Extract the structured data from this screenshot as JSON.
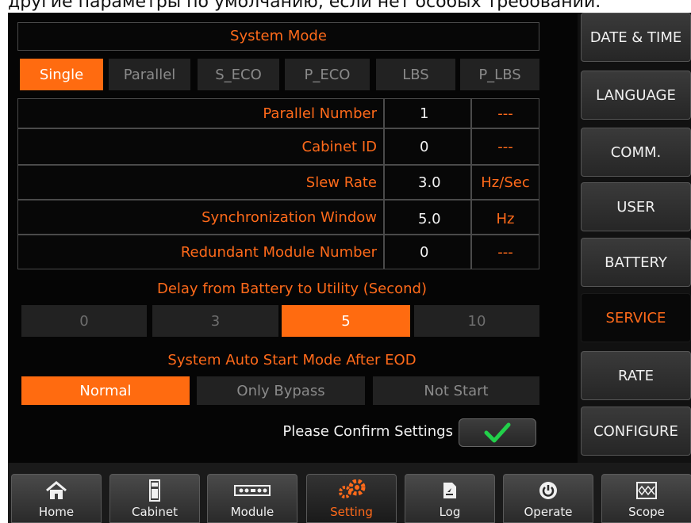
{
  "top_caption": "другие параметры по умолчанию, если нет особых требований.",
  "system_mode": {
    "title": "System Mode",
    "options": [
      "Single",
      "Parallel",
      "S_ECO",
      "P_ECO",
      "LBS",
      "P_LBS"
    ],
    "selected": "Single"
  },
  "params": [
    {
      "label": "Parallel Number",
      "value": "1",
      "unit": "---"
    },
    {
      "label": "Cabinet ID",
      "value": "0",
      "unit": "---"
    },
    {
      "label": "Slew Rate",
      "value": "3.0",
      "unit": "Hz/Sec"
    },
    {
      "label": "Synchronization Window",
      "value": "5.0",
      "unit": "Hz"
    },
    {
      "label": "Redundant Module Number",
      "value": "0",
      "unit": "---"
    }
  ],
  "delay": {
    "title": "Delay from Battery to Utility (Second)",
    "options": [
      "0",
      "3",
      "5",
      "10"
    ],
    "selected": "5"
  },
  "auto_start": {
    "title": "System Auto Start Mode After EOD",
    "options": [
      "Normal",
      "Only Bypass",
      "Not Start"
    ],
    "selected": "Normal"
  },
  "confirm": {
    "label": "Please Confirm Settings",
    "icon": "check-icon",
    "icon_color": "#22d04a"
  },
  "sidebar": {
    "items": [
      {
        "label": "DATE & TIME",
        "active": false
      },
      {
        "label": "LANGUAGE",
        "active": false
      },
      {
        "label": "COMM.",
        "active": false
      },
      {
        "label": "USER",
        "active": false
      },
      {
        "label": "BATTERY",
        "active": false
      },
      {
        "label": "SERVICE",
        "active": true
      },
      {
        "label": "RATE",
        "active": false
      },
      {
        "label": "CONFIGURE",
        "active": false
      }
    ]
  },
  "bottom_nav": {
    "items": [
      {
        "label": "Home",
        "icon": "home-icon"
      },
      {
        "label": "Cabinet",
        "icon": "cabinet-icon"
      },
      {
        "label": "Module",
        "icon": "module-icon"
      },
      {
        "label": "Setting",
        "icon": "gear-icon",
        "active": true
      },
      {
        "label": "Log",
        "icon": "log-icon"
      },
      {
        "label": "Operate",
        "icon": "power-icon"
      },
      {
        "label": "Scope",
        "icon": "scope-icon"
      }
    ]
  },
  "colors": {
    "accent": "#ff6b10",
    "background": "#050505",
    "confirm_check": "#22d04a"
  }
}
